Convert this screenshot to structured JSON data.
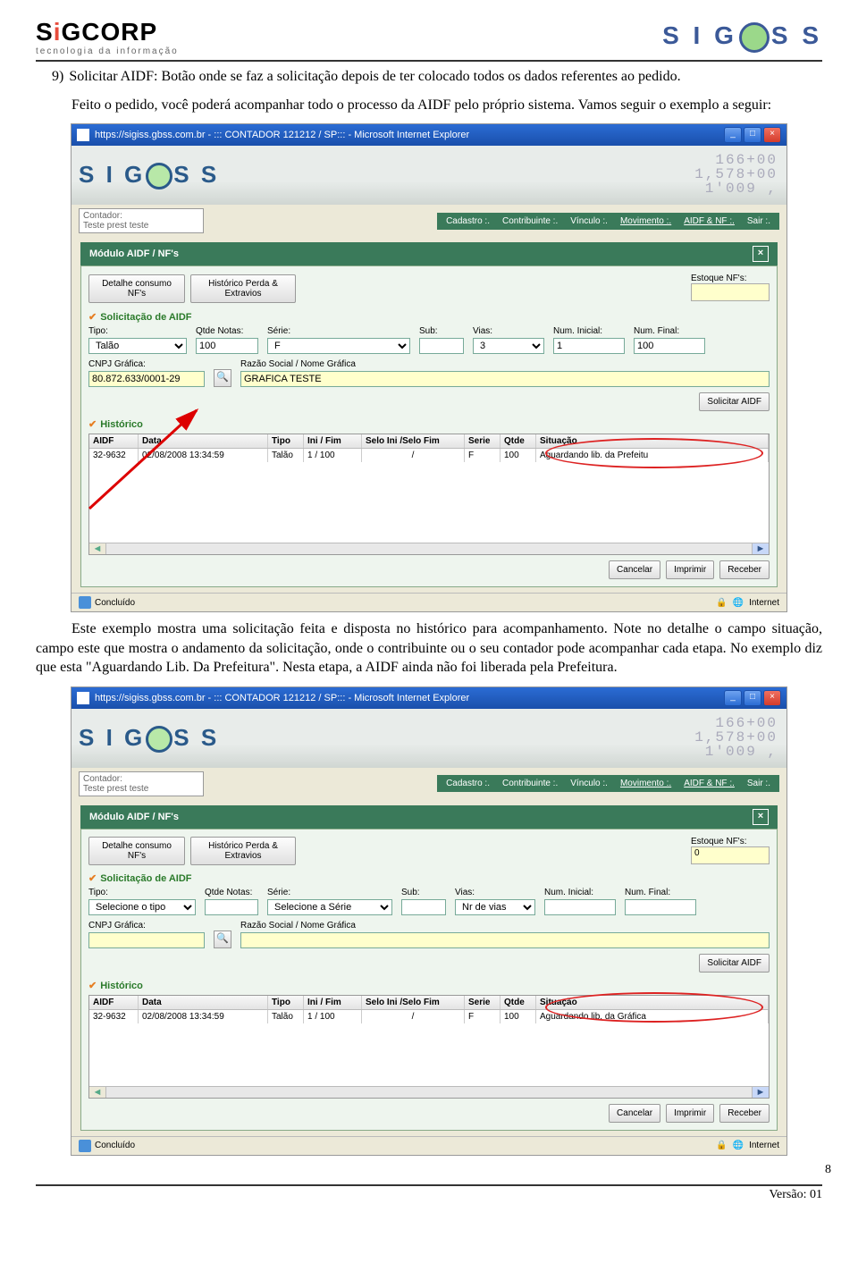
{
  "header": {
    "logo_main": "S",
    "logo_i": "i",
    "logo_rest": "GCORP",
    "logo_sub": "tecnologia da informação",
    "logo2": "S I G",
    "logo2b": "S S"
  },
  "para1_lead": "9)",
  "para1": "Solicitar AIDF: Botão onde se faz a solicitação depois de ter colocado todos os dados referentes ao pedido.",
  "para2": "Feito o pedido, você poderá acompanhar todo o processo da AIDF pelo próprio sistema. Vamos seguir o exemplo a seguir:",
  "para3": "Este exemplo mostra uma solicitação feita e disposta no histórico para acompanhamento. Note no detalhe o campo situação, campo este que mostra o andamento da solicitação, onde o contribuinte ou o seu contador pode acompanhar cada etapa. No exemplo diz que esta \"Aguardando Lib. Da Prefeitura\". Nesta etapa, a AIDF ainda não foi liberada pela Prefeitura.",
  "win": {
    "title": "https://sigiss.gbss.com.br - ::: CONTADOR 121212 / SP::: - Microsoft Internet Explorer",
    "user_lbl": "Contador:",
    "user_val": "Teste prest teste",
    "menu": [
      "Cadastro :.",
      "Contribuinte :.",
      "Vínculo :.",
      "Movimento :.",
      "AIDF & NF :.",
      "Sair :."
    ],
    "mod": "Módulo AIDF / NF's",
    "btn_det": "Detalhe consumo NF's",
    "btn_hist": "Histórico Perda & Extravios",
    "est_lbl": "Estoque NF's:",
    "est_val": "0",
    "sec1": "Solicitação de AIDF",
    "lbl": {
      "tipo": "Tipo:",
      "qtde": "Qtde Notas:",
      "serie": "Série:",
      "sub": "Sub:",
      "vias": "Vias:",
      "numi": "Num. Inicial:",
      "numf": "Num. Final:",
      "cnpj": "CNPJ Gráfica:",
      "razao": "Razão Social / Nome Gráfica"
    },
    "val1": {
      "tipo": "Talão",
      "qtde": "100",
      "serie": "F",
      "sub": "",
      "vias": "3",
      "numi": "1",
      "numf": "100",
      "cnpj": "80.872.633/0001-29",
      "razao": "GRAFICA TESTE"
    },
    "val2": {
      "tipo": "Selecione o tipo",
      "qtde": "",
      "serie": "Selecione a Série",
      "sub": "",
      "vias": "Nr de vias",
      "numi": "",
      "numf": "",
      "cnpj": "",
      "razao": ""
    },
    "btn_sol": "Solicitar AIDF",
    "sec2": "Histórico",
    "th": {
      "aidf": "AIDF",
      "data": "Data",
      "tipo": "Tipo",
      "inifim": "Ini / Fim",
      "selo": "Selo Ini /Selo Fim",
      "serie": "Serie",
      "qtde": "Qtde",
      "sit": "Situação"
    },
    "row1": {
      "aidf": "32-9632",
      "data": "02/08/2008 13:34:59",
      "tipo": "Talão",
      "inifim": "1 / 100",
      "selo": "/",
      "serie": "F",
      "qtde": "100",
      "sit": "Aguardando lib. da Prefeitu"
    },
    "row2": {
      "aidf": "32-9632",
      "data": "02/08/2008 13:34:59",
      "tipo": "Talão",
      "inifim": "1 / 100",
      "selo": "/",
      "serie": "F",
      "qtde": "100",
      "sit": "Aguardando lib. da Gráfica"
    },
    "btn_canc": "Cancelar",
    "btn_imp": "Imprimir",
    "btn_rec": "Receber",
    "status": "Concluído",
    "net": "Internet"
  },
  "numbg": "166+00\n1,578+00\n1'009 ,",
  "page_num": "8",
  "version": "Versão: 01"
}
